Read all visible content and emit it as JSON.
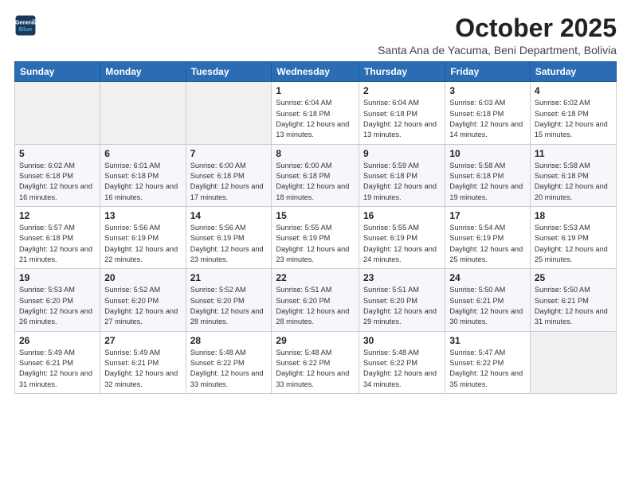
{
  "logo": {
    "line1": "General",
    "line2": "Blue"
  },
  "title": "October 2025",
  "location": "Santa Ana de Yacuma, Beni Department, Bolivia",
  "weekdays": [
    "Sunday",
    "Monday",
    "Tuesday",
    "Wednesday",
    "Thursday",
    "Friday",
    "Saturday"
  ],
  "weeks": [
    [
      {
        "num": "",
        "sunrise": "",
        "sunset": "",
        "daylight": ""
      },
      {
        "num": "",
        "sunrise": "",
        "sunset": "",
        "daylight": ""
      },
      {
        "num": "",
        "sunrise": "",
        "sunset": "",
        "daylight": ""
      },
      {
        "num": "1",
        "sunrise": "Sunrise: 6:04 AM",
        "sunset": "Sunset: 6:18 PM",
        "daylight": "Daylight: 12 hours and 13 minutes."
      },
      {
        "num": "2",
        "sunrise": "Sunrise: 6:04 AM",
        "sunset": "Sunset: 6:18 PM",
        "daylight": "Daylight: 12 hours and 13 minutes."
      },
      {
        "num": "3",
        "sunrise": "Sunrise: 6:03 AM",
        "sunset": "Sunset: 6:18 PM",
        "daylight": "Daylight: 12 hours and 14 minutes."
      },
      {
        "num": "4",
        "sunrise": "Sunrise: 6:02 AM",
        "sunset": "Sunset: 6:18 PM",
        "daylight": "Daylight: 12 hours and 15 minutes."
      }
    ],
    [
      {
        "num": "5",
        "sunrise": "Sunrise: 6:02 AM",
        "sunset": "Sunset: 6:18 PM",
        "daylight": "Daylight: 12 hours and 16 minutes."
      },
      {
        "num": "6",
        "sunrise": "Sunrise: 6:01 AM",
        "sunset": "Sunset: 6:18 PM",
        "daylight": "Daylight: 12 hours and 16 minutes."
      },
      {
        "num": "7",
        "sunrise": "Sunrise: 6:00 AM",
        "sunset": "Sunset: 6:18 PM",
        "daylight": "Daylight: 12 hours and 17 minutes."
      },
      {
        "num": "8",
        "sunrise": "Sunrise: 6:00 AM",
        "sunset": "Sunset: 6:18 PM",
        "daylight": "Daylight: 12 hours and 18 minutes."
      },
      {
        "num": "9",
        "sunrise": "Sunrise: 5:59 AM",
        "sunset": "Sunset: 6:18 PM",
        "daylight": "Daylight: 12 hours and 19 minutes."
      },
      {
        "num": "10",
        "sunrise": "Sunrise: 5:58 AM",
        "sunset": "Sunset: 6:18 PM",
        "daylight": "Daylight: 12 hours and 19 minutes."
      },
      {
        "num": "11",
        "sunrise": "Sunrise: 5:58 AM",
        "sunset": "Sunset: 6:18 PM",
        "daylight": "Daylight: 12 hours and 20 minutes."
      }
    ],
    [
      {
        "num": "12",
        "sunrise": "Sunrise: 5:57 AM",
        "sunset": "Sunset: 6:18 PM",
        "daylight": "Daylight: 12 hours and 21 minutes."
      },
      {
        "num": "13",
        "sunrise": "Sunrise: 5:56 AM",
        "sunset": "Sunset: 6:19 PM",
        "daylight": "Daylight: 12 hours and 22 minutes."
      },
      {
        "num": "14",
        "sunrise": "Sunrise: 5:56 AM",
        "sunset": "Sunset: 6:19 PM",
        "daylight": "Daylight: 12 hours and 23 minutes."
      },
      {
        "num": "15",
        "sunrise": "Sunrise: 5:55 AM",
        "sunset": "Sunset: 6:19 PM",
        "daylight": "Daylight: 12 hours and 23 minutes."
      },
      {
        "num": "16",
        "sunrise": "Sunrise: 5:55 AM",
        "sunset": "Sunset: 6:19 PM",
        "daylight": "Daylight: 12 hours and 24 minutes."
      },
      {
        "num": "17",
        "sunrise": "Sunrise: 5:54 AM",
        "sunset": "Sunset: 6:19 PM",
        "daylight": "Daylight: 12 hours and 25 minutes."
      },
      {
        "num": "18",
        "sunrise": "Sunrise: 5:53 AM",
        "sunset": "Sunset: 6:19 PM",
        "daylight": "Daylight: 12 hours and 25 minutes."
      }
    ],
    [
      {
        "num": "19",
        "sunrise": "Sunrise: 5:53 AM",
        "sunset": "Sunset: 6:20 PM",
        "daylight": "Daylight: 12 hours and 26 minutes."
      },
      {
        "num": "20",
        "sunrise": "Sunrise: 5:52 AM",
        "sunset": "Sunset: 6:20 PM",
        "daylight": "Daylight: 12 hours and 27 minutes."
      },
      {
        "num": "21",
        "sunrise": "Sunrise: 5:52 AM",
        "sunset": "Sunset: 6:20 PM",
        "daylight": "Daylight: 12 hours and 28 minutes."
      },
      {
        "num": "22",
        "sunrise": "Sunrise: 5:51 AM",
        "sunset": "Sunset: 6:20 PM",
        "daylight": "Daylight: 12 hours and 28 minutes."
      },
      {
        "num": "23",
        "sunrise": "Sunrise: 5:51 AM",
        "sunset": "Sunset: 6:20 PM",
        "daylight": "Daylight: 12 hours and 29 minutes."
      },
      {
        "num": "24",
        "sunrise": "Sunrise: 5:50 AM",
        "sunset": "Sunset: 6:21 PM",
        "daylight": "Daylight: 12 hours and 30 minutes."
      },
      {
        "num": "25",
        "sunrise": "Sunrise: 5:50 AM",
        "sunset": "Sunset: 6:21 PM",
        "daylight": "Daylight: 12 hours and 31 minutes."
      }
    ],
    [
      {
        "num": "26",
        "sunrise": "Sunrise: 5:49 AM",
        "sunset": "Sunset: 6:21 PM",
        "daylight": "Daylight: 12 hours and 31 minutes."
      },
      {
        "num": "27",
        "sunrise": "Sunrise: 5:49 AM",
        "sunset": "Sunset: 6:21 PM",
        "daylight": "Daylight: 12 hours and 32 minutes."
      },
      {
        "num": "28",
        "sunrise": "Sunrise: 5:48 AM",
        "sunset": "Sunset: 6:22 PM",
        "daylight": "Daylight: 12 hours and 33 minutes."
      },
      {
        "num": "29",
        "sunrise": "Sunrise: 5:48 AM",
        "sunset": "Sunset: 6:22 PM",
        "daylight": "Daylight: 12 hours and 33 minutes."
      },
      {
        "num": "30",
        "sunrise": "Sunrise: 5:48 AM",
        "sunset": "Sunset: 6:22 PM",
        "daylight": "Daylight: 12 hours and 34 minutes."
      },
      {
        "num": "31",
        "sunrise": "Sunrise: 5:47 AM",
        "sunset": "Sunset: 6:22 PM",
        "daylight": "Daylight: 12 hours and 35 minutes."
      },
      {
        "num": "",
        "sunrise": "",
        "sunset": "",
        "daylight": ""
      }
    ]
  ]
}
